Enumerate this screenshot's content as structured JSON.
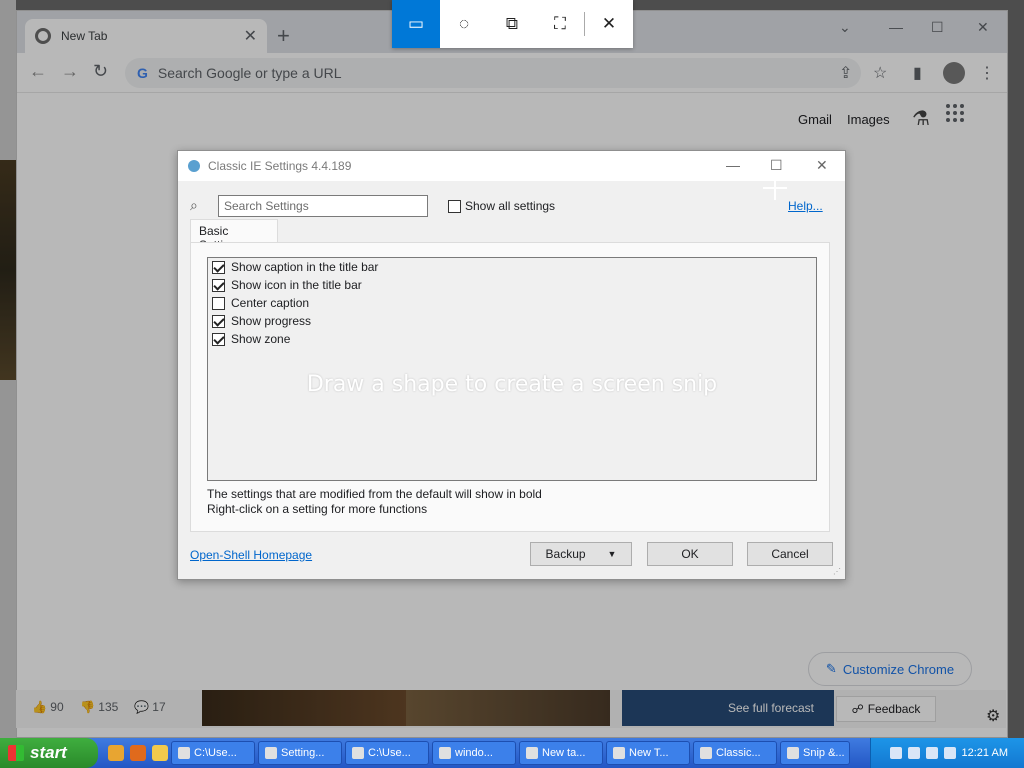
{
  "browser": {
    "tab_title": "New Tab",
    "new_tab": "+",
    "omnibox_placeholder": "Search Google or type a URL",
    "google_g": "G",
    "links": {
      "gmail": "Gmail",
      "images": "Images"
    },
    "customize": "Customize Chrome",
    "icons": {
      "back": "←",
      "forward": "→",
      "reload": "↻",
      "share": "⇪",
      "star": "☆",
      "panel": "▮",
      "menu": "⋮",
      "min": "—",
      "max": "☐",
      "close": "✕",
      "pencil": "✎",
      "lab": "⚗",
      "feedback": "☍",
      "gear": "⚙"
    }
  },
  "news": {
    "likes": "90",
    "dislikes": "135",
    "comments": "17",
    "forecast": "See full forecast",
    "feedback": "Feedback"
  },
  "dialog": {
    "title": "Classic IE Settings 4.4.189",
    "search_placeholder": "Search Settings",
    "show_all": "Show all settings",
    "help": "Help...",
    "tab": "Basic Settings",
    "items": [
      {
        "label": "Show caption in the title bar",
        "checked": true
      },
      {
        "label": "Show icon in the title bar",
        "checked": true
      },
      {
        "label": "Center caption",
        "checked": false
      },
      {
        "label": "Show progress",
        "checked": true
      },
      {
        "label": "Show zone",
        "checked": true
      }
    ],
    "note1": "The settings that are modified from the default will show in bold",
    "note2": "Right-click on a setting for more functions",
    "homepage": "Open-Shell Homepage",
    "backup": "Backup",
    "ok": "OK",
    "cancel": "Cancel"
  },
  "snip": {
    "message": "Draw a shape to create a screen snip",
    "icons": {
      "rect": "▭",
      "free": "◌",
      "window": "⧉",
      "full": "⛶",
      "close": "✕"
    }
  },
  "taskbar": {
    "start": "start",
    "tasks": [
      "C:\\Use...",
      "Setting...",
      "C:\\Use...",
      "windo...",
      "New ta...",
      "New T...",
      "Classic...",
      "Snip &..."
    ],
    "clock": "12:21 AM"
  }
}
